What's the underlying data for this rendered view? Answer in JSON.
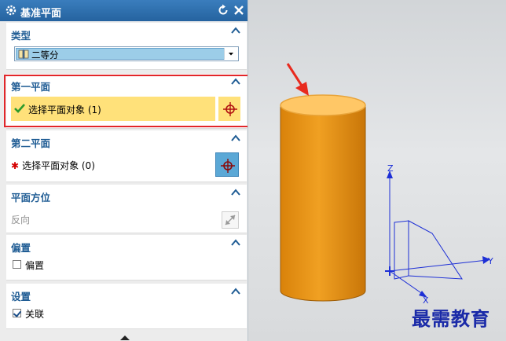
{
  "dialog": {
    "title": "基准平面"
  },
  "sections": {
    "type": {
      "title": "类型",
      "selected": "二等分"
    },
    "first_plane": {
      "title": "第一平面",
      "select_label": "选择平面对象 (1)"
    },
    "second_plane": {
      "title": "第二平面",
      "select_label": "选择平面对象 (0)"
    },
    "orientation": {
      "title": "平面方位",
      "reverse_label": "反向"
    },
    "offset": {
      "title": "偏置",
      "checkbox_label": "偏置",
      "checked": false
    },
    "settings": {
      "title": "设置",
      "checkbox_label": "关联",
      "checked": true
    }
  },
  "viewport": {
    "axis_z": "Z",
    "axis_y": "Y",
    "axis_x": "X",
    "watermark": "最需教育"
  },
  "colors": {
    "title_bar": "#2f71b0",
    "section_heading": "#1f5c94",
    "active_selection": "#ffe17a",
    "cylinder": "#e8960f",
    "cylinder_top_highlight": "#ffc766",
    "highlight_border": "#e2262a",
    "axes": "#1d2fd6"
  },
  "icons": {
    "title": "gear-icon",
    "reset": "reset-icon",
    "close": "close-icon",
    "collapse": "chevron-up-icon",
    "select_target": "crosshair-icon",
    "satisfied": "checkmark-icon",
    "required": "asterisk-icon",
    "reverse": "flip-arrows-icon",
    "type_option": "bisector-icon"
  }
}
